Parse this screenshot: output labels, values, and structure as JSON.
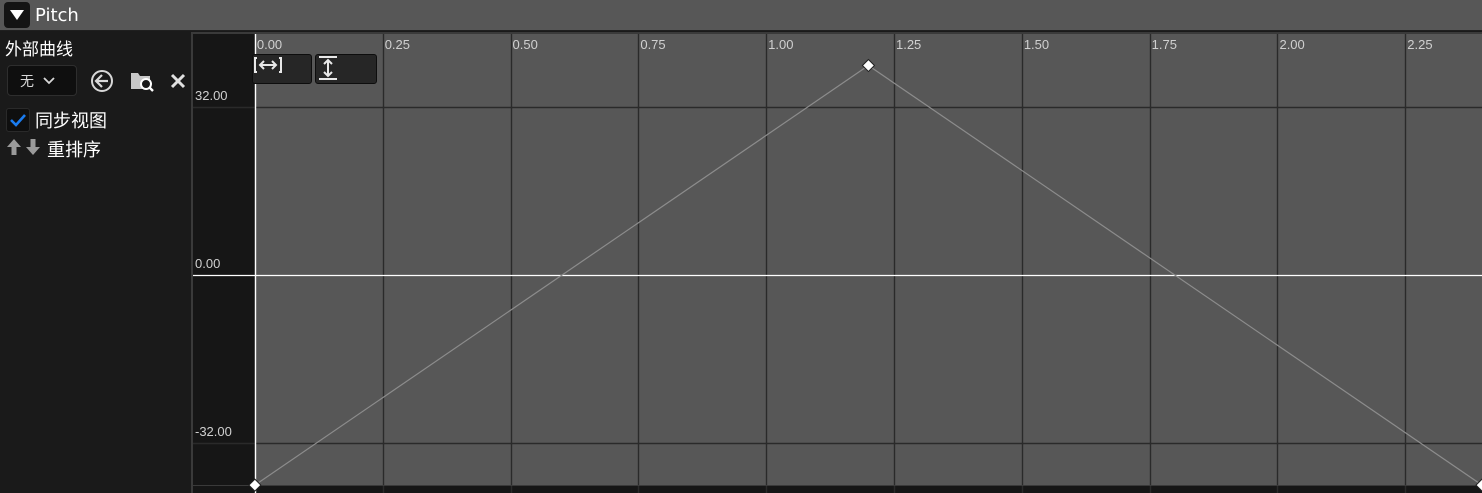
{
  "header": {
    "title": "Pitch",
    "collapse_icon": "triangle-down-icon"
  },
  "left_panel": {
    "external_curve_label": "外部曲线",
    "curve_combo_value": "无",
    "sync_view": {
      "label": "同步视图",
      "checked": true
    },
    "reorder_label": "重排序",
    "icons": [
      "back-arrow-icon",
      "browse-folder-icon",
      "close-icon",
      "arrow-up-icon",
      "arrow-down-icon"
    ]
  },
  "graph": {
    "toolbar": {
      "fit_horizontal_icon": "fit-horizontal-icon",
      "fit_vertical_icon": "fit-vertical-icon"
    },
    "colors": {
      "grid_bg": "#575757",
      "margin_bg": "#161616",
      "grid_line": "#2a2a2a",
      "zero_line": "#ffffff",
      "curve": "#8c8c8c",
      "key": "#ffffff"
    }
  },
  "chart_data": {
    "type": "line",
    "x_ticks": [
      "0.00",
      "0.25",
      "0.50",
      "0.75",
      "1.00",
      "1.25",
      "1.50",
      "1.75",
      "2.00",
      "2.25"
    ],
    "x_tick_values": [
      0,
      0.25,
      0.5,
      0.75,
      1.0,
      1.25,
      1.5,
      1.75,
      2.0,
      2.25
    ],
    "y_ticks": [
      "32.00",
      "0.00",
      "-32.00"
    ],
    "y_tick_values": [
      32,
      0,
      -32
    ],
    "xlim": [
      -0.121,
      2.4
    ],
    "ylim": [
      -41.5,
      46
    ],
    "series": [
      {
        "points": [
          [
            0.0,
            -40
          ],
          [
            1.2,
            40
          ],
          [
            2.4,
            -40
          ]
        ]
      }
    ],
    "grid": true
  }
}
